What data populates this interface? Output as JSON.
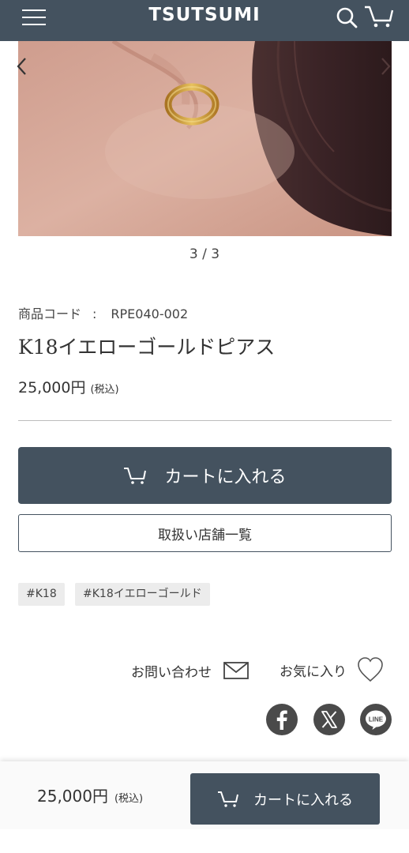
{
  "header": {
    "logo": "TSUTSUMI",
    "menu_icon": "hamburger-menu-icon",
    "search_icon": "search-icon",
    "cart_icon": "cart-icon"
  },
  "gallery": {
    "pager": "3 / 3",
    "prev_icon": "chevron-left-icon",
    "next_icon": "chevron-right-icon",
    "image_description": "ear wearing gold hoop earring"
  },
  "product": {
    "code_label": "商品コード",
    "code_separator": ":",
    "code_value": "RPE040-002",
    "name": "K18イエローゴールドピアス",
    "price": "25,000円",
    "tax_note": "(税込)"
  },
  "actions": {
    "add_to_cart": "カートに入れる",
    "store_list": "取扱い店舗一覧",
    "contact": "お問い合わせ",
    "favorite": "お気に入り"
  },
  "tags": [
    "#K18",
    "#K18イエローゴールド"
  ],
  "share": {
    "icons": [
      "facebook-icon",
      "x-icon",
      "line-icon"
    ],
    "line_text": "LINE"
  },
  "sticky_bar": {
    "price": "25,000円",
    "tax_note": "(税込)",
    "add_to_cart": "カートに入れる"
  },
  "colors": {
    "primary": "#44525f",
    "tag_bg": "#ececec",
    "social": "#4a4a4a"
  }
}
